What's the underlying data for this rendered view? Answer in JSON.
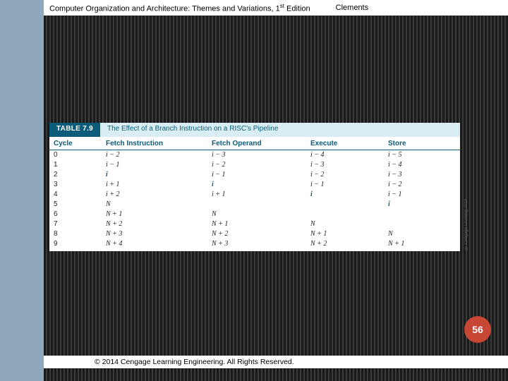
{
  "header": {
    "book_title_pre": "Computer Organization and Architecture: Themes and Variations, 1",
    "book_title_sup": "st",
    "book_title_post": " Edition",
    "author": "Clements"
  },
  "table": {
    "tag": "TABLE 7.9",
    "caption": "The Effect of a Branch Instruction on a RISC's Pipeline",
    "side_credit": "© Cengage Learning 2014",
    "columns": [
      "Cycle",
      "Fetch Instruction",
      "Fetch Operand",
      "Execute",
      "Store"
    ],
    "rows": [
      {
        "cycle": "0",
        "fi": "i − 2",
        "fo": "i − 3",
        "ex": "i − 4",
        "st": "i − 5",
        "bold": {
          "fi": false,
          "fo": false,
          "ex": false,
          "st": false
        }
      },
      {
        "cycle": "1",
        "fi": "i − 1",
        "fo": "i − 2",
        "ex": "i − 3",
        "st": "i − 4",
        "bold": {
          "fi": false,
          "fo": false,
          "ex": false,
          "st": false
        }
      },
      {
        "cycle": "2",
        "fi": "i",
        "fo": "i − 1",
        "ex": "i − 2",
        "st": "i − 3",
        "bold": {
          "fi": true,
          "fo": false,
          "ex": false,
          "st": false
        }
      },
      {
        "cycle": "3",
        "fi": "i + 1",
        "fo": "i",
        "ex": "i − 1",
        "st": "i − 2",
        "bold": {
          "fi": false,
          "fo": true,
          "ex": false,
          "st": false
        }
      },
      {
        "cycle": "4",
        "fi": "i + 2",
        "fo": "i + 1",
        "ex": "i",
        "st": "i − 1",
        "bold": {
          "fi": false,
          "fo": false,
          "ex": true,
          "st": false
        }
      },
      {
        "cycle": "5",
        "fi": "N",
        "fo": "",
        "ex": "",
        "st": "i",
        "bold": {
          "fi": false,
          "fo": false,
          "ex": false,
          "st": true
        }
      },
      {
        "cycle": "6",
        "fi": "N + 1",
        "fo": "N",
        "ex": "",
        "st": "",
        "bold": {
          "fi": false,
          "fo": false,
          "ex": false,
          "st": false
        }
      },
      {
        "cycle": "7",
        "fi": "N + 2",
        "fo": "N + 1",
        "ex": "N",
        "st": "",
        "bold": {
          "fi": false,
          "fo": false,
          "ex": false,
          "st": false
        }
      },
      {
        "cycle": "8",
        "fi": "N + 3",
        "fo": "N + 2",
        "ex": "N + 1",
        "st": "N",
        "bold": {
          "fi": false,
          "fo": false,
          "ex": false,
          "st": false
        }
      },
      {
        "cycle": "9",
        "fi": "N + 4",
        "fo": "N + 3",
        "ex": "N + 2",
        "st": "N + 1",
        "bold": {
          "fi": false,
          "fo": false,
          "ex": false,
          "st": false
        }
      }
    ]
  },
  "page_number": "56",
  "copyright": "© 2014 Cengage Learning Engineering. All Rights Reserved."
}
